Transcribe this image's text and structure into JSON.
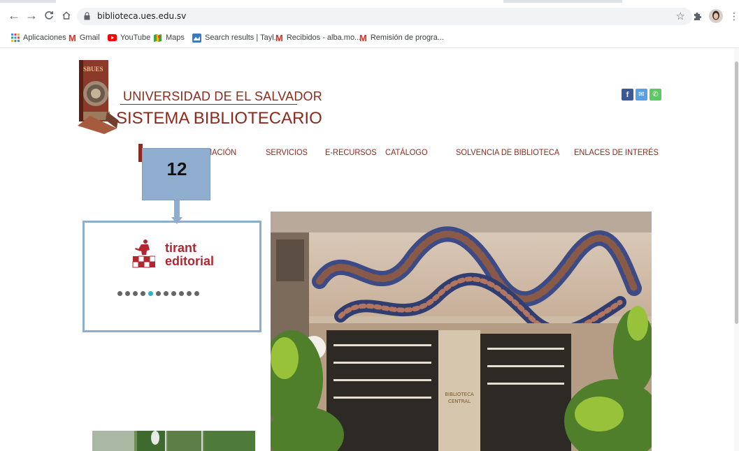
{
  "browser": {
    "url": "biblioteca.ues.edu.sv",
    "bookmarks": [
      {
        "label": "Aplicaciones",
        "icon": "apps-grid-icon"
      },
      {
        "label": "Gmail",
        "icon": "gmail-icon"
      },
      {
        "label": "YouTube",
        "icon": "youtube-icon"
      },
      {
        "label": "Maps",
        "icon": "maps-icon"
      },
      {
        "label": "Search results | Tayl...",
        "icon": "search-results-icon"
      },
      {
        "label": "Recibidos - alba.mo...",
        "icon": "gmail-icon"
      },
      {
        "label": "Remisión de progra...",
        "icon": "gmail-icon"
      }
    ]
  },
  "site": {
    "university": "UNIVERSIDAD DE EL SALVADOR",
    "system": "SISTEMA BIBLIOTECARIO",
    "emblem_text": "SBUES",
    "nav": [
      {
        "label": "RMACIÓN"
      },
      {
        "label": "SERVICIOS"
      },
      {
        "label": "E-RECURSOS"
      },
      {
        "label": "CATÁLOGO"
      },
      {
        "label": "SOLVENCIA DE BIBLIOTECA"
      },
      {
        "label": "ENLACES DE INTERÉS"
      }
    ],
    "social": [
      {
        "name": "facebook",
        "glyph": "f",
        "color": "#3b5998"
      },
      {
        "name": "email",
        "glyph": "✉",
        "color": "#5aa0e6"
      },
      {
        "name": "phone",
        "glyph": "✆",
        "color": "#5cc964"
      }
    ],
    "carousel": {
      "partner_line1": "tirant",
      "partner_line2": "editorial",
      "total_slides": 11,
      "active_slide": 5
    },
    "hero_sign_line1": "BIBLIOTECA",
    "hero_sign_line2": "CENTRAL"
  },
  "annotation": {
    "number": "12"
  },
  "colors": {
    "brand": "#8b2a1d",
    "callout": "#8faecf",
    "tirant": "#b4262f",
    "carousel_active": "#2db3c1"
  }
}
